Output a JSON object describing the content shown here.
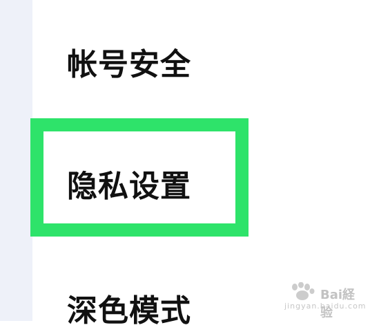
{
  "menu": {
    "items": [
      {
        "label": "帐号安全"
      },
      {
        "label": "隐私设置"
      },
      {
        "label": "深色模式"
      }
    ]
  },
  "watermark": {
    "brand_text": "Bai経验",
    "url_text": "jingyan.baidu.com"
  },
  "colors": {
    "highlight": "#2ee36a",
    "left_strip": "#eef1f9",
    "text": "#111111"
  },
  "icons": {
    "watermark_logo": "baidu-paw-icon"
  }
}
